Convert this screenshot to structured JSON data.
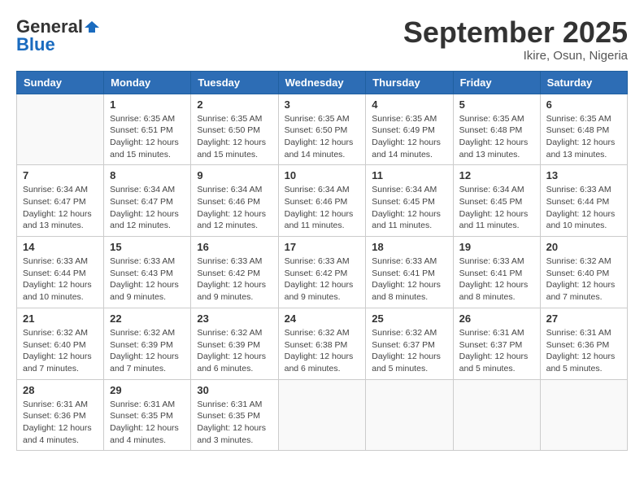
{
  "logo": {
    "general": "General",
    "blue": "Blue"
  },
  "title": "September 2025",
  "location": "Ikire, Osun, Nigeria",
  "headers": [
    "Sunday",
    "Monday",
    "Tuesday",
    "Wednesday",
    "Thursday",
    "Friday",
    "Saturday"
  ],
  "weeks": [
    [
      {
        "day": "",
        "info": ""
      },
      {
        "day": "1",
        "info": "Sunrise: 6:35 AM\nSunset: 6:51 PM\nDaylight: 12 hours\nand 15 minutes."
      },
      {
        "day": "2",
        "info": "Sunrise: 6:35 AM\nSunset: 6:50 PM\nDaylight: 12 hours\nand 15 minutes."
      },
      {
        "day": "3",
        "info": "Sunrise: 6:35 AM\nSunset: 6:50 PM\nDaylight: 12 hours\nand 14 minutes."
      },
      {
        "day": "4",
        "info": "Sunrise: 6:35 AM\nSunset: 6:49 PM\nDaylight: 12 hours\nand 14 minutes."
      },
      {
        "day": "5",
        "info": "Sunrise: 6:35 AM\nSunset: 6:48 PM\nDaylight: 12 hours\nand 13 minutes."
      },
      {
        "day": "6",
        "info": "Sunrise: 6:35 AM\nSunset: 6:48 PM\nDaylight: 12 hours\nand 13 minutes."
      }
    ],
    [
      {
        "day": "7",
        "info": "Sunrise: 6:34 AM\nSunset: 6:47 PM\nDaylight: 12 hours\nand 13 minutes."
      },
      {
        "day": "8",
        "info": "Sunrise: 6:34 AM\nSunset: 6:47 PM\nDaylight: 12 hours\nand 12 minutes."
      },
      {
        "day": "9",
        "info": "Sunrise: 6:34 AM\nSunset: 6:46 PM\nDaylight: 12 hours\nand 12 minutes."
      },
      {
        "day": "10",
        "info": "Sunrise: 6:34 AM\nSunset: 6:46 PM\nDaylight: 12 hours\nand 11 minutes."
      },
      {
        "day": "11",
        "info": "Sunrise: 6:34 AM\nSunset: 6:45 PM\nDaylight: 12 hours\nand 11 minutes."
      },
      {
        "day": "12",
        "info": "Sunrise: 6:34 AM\nSunset: 6:45 PM\nDaylight: 12 hours\nand 11 minutes."
      },
      {
        "day": "13",
        "info": "Sunrise: 6:33 AM\nSunset: 6:44 PM\nDaylight: 12 hours\nand 10 minutes."
      }
    ],
    [
      {
        "day": "14",
        "info": "Sunrise: 6:33 AM\nSunset: 6:44 PM\nDaylight: 12 hours\nand 10 minutes."
      },
      {
        "day": "15",
        "info": "Sunrise: 6:33 AM\nSunset: 6:43 PM\nDaylight: 12 hours\nand 9 minutes."
      },
      {
        "day": "16",
        "info": "Sunrise: 6:33 AM\nSunset: 6:42 PM\nDaylight: 12 hours\nand 9 minutes."
      },
      {
        "day": "17",
        "info": "Sunrise: 6:33 AM\nSunset: 6:42 PM\nDaylight: 12 hours\nand 9 minutes."
      },
      {
        "day": "18",
        "info": "Sunrise: 6:33 AM\nSunset: 6:41 PM\nDaylight: 12 hours\nand 8 minutes."
      },
      {
        "day": "19",
        "info": "Sunrise: 6:33 AM\nSunset: 6:41 PM\nDaylight: 12 hours\nand 8 minutes."
      },
      {
        "day": "20",
        "info": "Sunrise: 6:32 AM\nSunset: 6:40 PM\nDaylight: 12 hours\nand 7 minutes."
      }
    ],
    [
      {
        "day": "21",
        "info": "Sunrise: 6:32 AM\nSunset: 6:40 PM\nDaylight: 12 hours\nand 7 minutes."
      },
      {
        "day": "22",
        "info": "Sunrise: 6:32 AM\nSunset: 6:39 PM\nDaylight: 12 hours\nand 7 minutes."
      },
      {
        "day": "23",
        "info": "Sunrise: 6:32 AM\nSunset: 6:39 PM\nDaylight: 12 hours\nand 6 minutes."
      },
      {
        "day": "24",
        "info": "Sunrise: 6:32 AM\nSunset: 6:38 PM\nDaylight: 12 hours\nand 6 minutes."
      },
      {
        "day": "25",
        "info": "Sunrise: 6:32 AM\nSunset: 6:37 PM\nDaylight: 12 hours\nand 5 minutes."
      },
      {
        "day": "26",
        "info": "Sunrise: 6:31 AM\nSunset: 6:37 PM\nDaylight: 12 hours\nand 5 minutes."
      },
      {
        "day": "27",
        "info": "Sunrise: 6:31 AM\nSunset: 6:36 PM\nDaylight: 12 hours\nand 5 minutes."
      }
    ],
    [
      {
        "day": "28",
        "info": "Sunrise: 6:31 AM\nSunset: 6:36 PM\nDaylight: 12 hours\nand 4 minutes."
      },
      {
        "day": "29",
        "info": "Sunrise: 6:31 AM\nSunset: 6:35 PM\nDaylight: 12 hours\nand 4 minutes."
      },
      {
        "day": "30",
        "info": "Sunrise: 6:31 AM\nSunset: 6:35 PM\nDaylight: 12 hours\nand 3 minutes."
      },
      {
        "day": "",
        "info": ""
      },
      {
        "day": "",
        "info": ""
      },
      {
        "day": "",
        "info": ""
      },
      {
        "day": "",
        "info": ""
      }
    ]
  ]
}
